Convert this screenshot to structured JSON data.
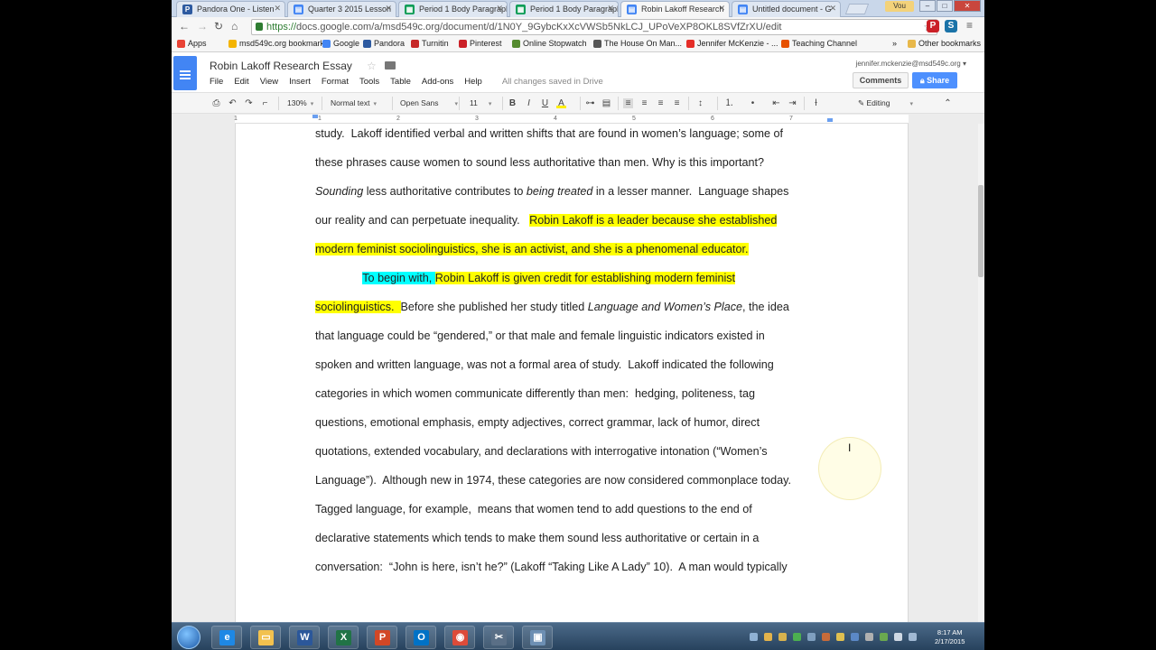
{
  "browser": {
    "tabs": [
      {
        "title": "Pandora One - Listen",
        "color": "#2d5aa0",
        "glyph": "P"
      },
      {
        "title": "Quarter 3 2015 Lesson",
        "color": "#4285f4",
        "glyph": "▤"
      },
      {
        "title": "Period 1 Body Paragraph",
        "color": "#0f9d58",
        "glyph": "▦"
      },
      {
        "title": "Period 1 Body Paragraph",
        "color": "#0f9d58",
        "glyph": "▦"
      },
      {
        "title": "Robin Lakoff Research",
        "color": "#4285f4",
        "glyph": "▤",
        "active": true
      },
      {
        "title": "Untitled document - G",
        "color": "#4285f4",
        "glyph": "▤"
      }
    ],
    "user_chip": "Vou",
    "url_scheme": "https://",
    "url_rest": "docs.google.com/a/msd549c.org/document/d/1N0Y_9GybcKxXcVWSb5NkLCJ_UPoVeXP8OKL8SVfZrXU/edit",
    "bookmarks": [
      {
        "label": "Apps",
        "color": "#e94335"
      },
      {
        "label": "msd549c.org bookmarks",
        "color": "#f4b400"
      },
      {
        "label": "Google",
        "color": "#4285f4"
      },
      {
        "label": "Pandora",
        "color": "#2d5aa0"
      },
      {
        "label": "Turnitin",
        "color": "#c62828"
      },
      {
        "label": "Pinterest",
        "color": "#cb2027"
      },
      {
        "label": "Online Stopwatch",
        "color": "#558b2f"
      },
      {
        "label": "The House On Man...",
        "color": "#555555"
      },
      {
        "label": "Jennifer McKenzie - ...",
        "color": "#e52d27"
      },
      {
        "label": "Teaching Channel",
        "color": "#e65100"
      }
    ],
    "more_bookmarks": "»",
    "other_bookmarks": "Other bookmarks"
  },
  "docs": {
    "title": "Robin Lakoff Research Essay",
    "menu": [
      "File",
      "Edit",
      "View",
      "Insert",
      "Format",
      "Tools",
      "Table",
      "Add-ons",
      "Help"
    ],
    "save_status": "All changes saved in Drive",
    "account": "jennifer.mckenzie@msd549c.org",
    "comments_label": "Comments",
    "share_label": "Share",
    "toolbar": {
      "zoom": "130%",
      "style": "Normal text",
      "font": "Open Sans",
      "size": "11",
      "mode": "Editing"
    },
    "ruler_numbers": [
      "1",
      "1",
      "2",
      "3",
      "4",
      "5",
      "6",
      "7"
    ]
  },
  "document": {
    "lines": [
      [
        {
          "t": "study.  Lakoff identified verbal and written shifts that are found in women’s language; some of"
        }
      ],
      [
        {
          "t": "these phrases cause women to sound less authoritative than men. Why is this important?"
        }
      ],
      [
        {
          "t": "Sounding",
          "i": true
        },
        {
          "t": " less authoritative contributes to "
        },
        {
          "t": "being treated",
          "i": true
        },
        {
          "t": " in a lesser manner.  Language shapes"
        }
      ],
      [
        {
          "t": "our reality and can perpetuate inequality.   "
        },
        {
          "t": "Robin Lakoff is a leader because she established",
          "h": "y"
        }
      ],
      [
        {
          "t": "modern feminist sociolinguistics, she is an activist, and she is a phenomenal educator.",
          "h": "y"
        }
      ],
      [
        {
          "t": "               "
        },
        {
          "t": "To begin with, ",
          "h": "c"
        },
        {
          "t": "Robin Lakoff is given credit for establishing modern feminist",
          "h": "y"
        }
      ],
      [
        {
          "t": "sociolinguistics.  ",
          "h": "y"
        },
        {
          "t": "Before she published her study titled "
        },
        {
          "t": "Language and Women’s Place",
          "i": true
        },
        {
          "t": ", the idea"
        }
      ],
      [
        {
          "t": "that language could be “gendered,” or that male and female linguistic indicators existed in"
        }
      ],
      [
        {
          "t": "spoken and written language, was not a formal area of study.  Lakoff indicated the following"
        }
      ],
      [
        {
          "t": "categories in which women communicate differently than men:  hedging, politeness, tag"
        }
      ],
      [
        {
          "t": "questions, emotional emphasis, empty adjectives, correct grammar, lack of humor, direct"
        }
      ],
      [
        {
          "t": "quotations, extended vocabulary, and declarations with interrogative intonation (“Women’s"
        }
      ],
      [
        {
          "t": "Language”).  Although new in 1974, these categories are now considered commonplace today."
        }
      ],
      [
        {
          "t": "Tagged language, for example,  means that women tend to add questions to the end of"
        }
      ],
      [
        {
          "t": "declarative statements which tends to make them sound less authoritative or certain in a"
        }
      ],
      [
        {
          "t": "conversation:  “John is here, isn’t he?” (Lakoff “Taking Like A Lady” 10).  A man would typically"
        }
      ]
    ]
  },
  "taskbar": {
    "apps": [
      {
        "name": "internet-explorer",
        "color": "#1e88e5",
        "glyph": "e"
      },
      {
        "name": "file-explorer",
        "color": "#f2c14e",
        "glyph": "▭"
      },
      {
        "name": "word",
        "color": "#2b579a",
        "glyph": "W"
      },
      {
        "name": "excel",
        "color": "#217346",
        "glyph": "X"
      },
      {
        "name": "powerpoint",
        "color": "#d24726",
        "glyph": "P"
      },
      {
        "name": "outlook",
        "color": "#0072c6",
        "glyph": "O"
      },
      {
        "name": "chrome",
        "color": "#dd4b39",
        "glyph": "◉"
      },
      {
        "name": "snipping-tool",
        "color": "#5a6f86",
        "glyph": "✂"
      },
      {
        "name": "screen-recorder",
        "color": "#6d8fb3",
        "glyph": "▣"
      }
    ],
    "time": "8:17 AM",
    "date": "2/17/2015"
  }
}
